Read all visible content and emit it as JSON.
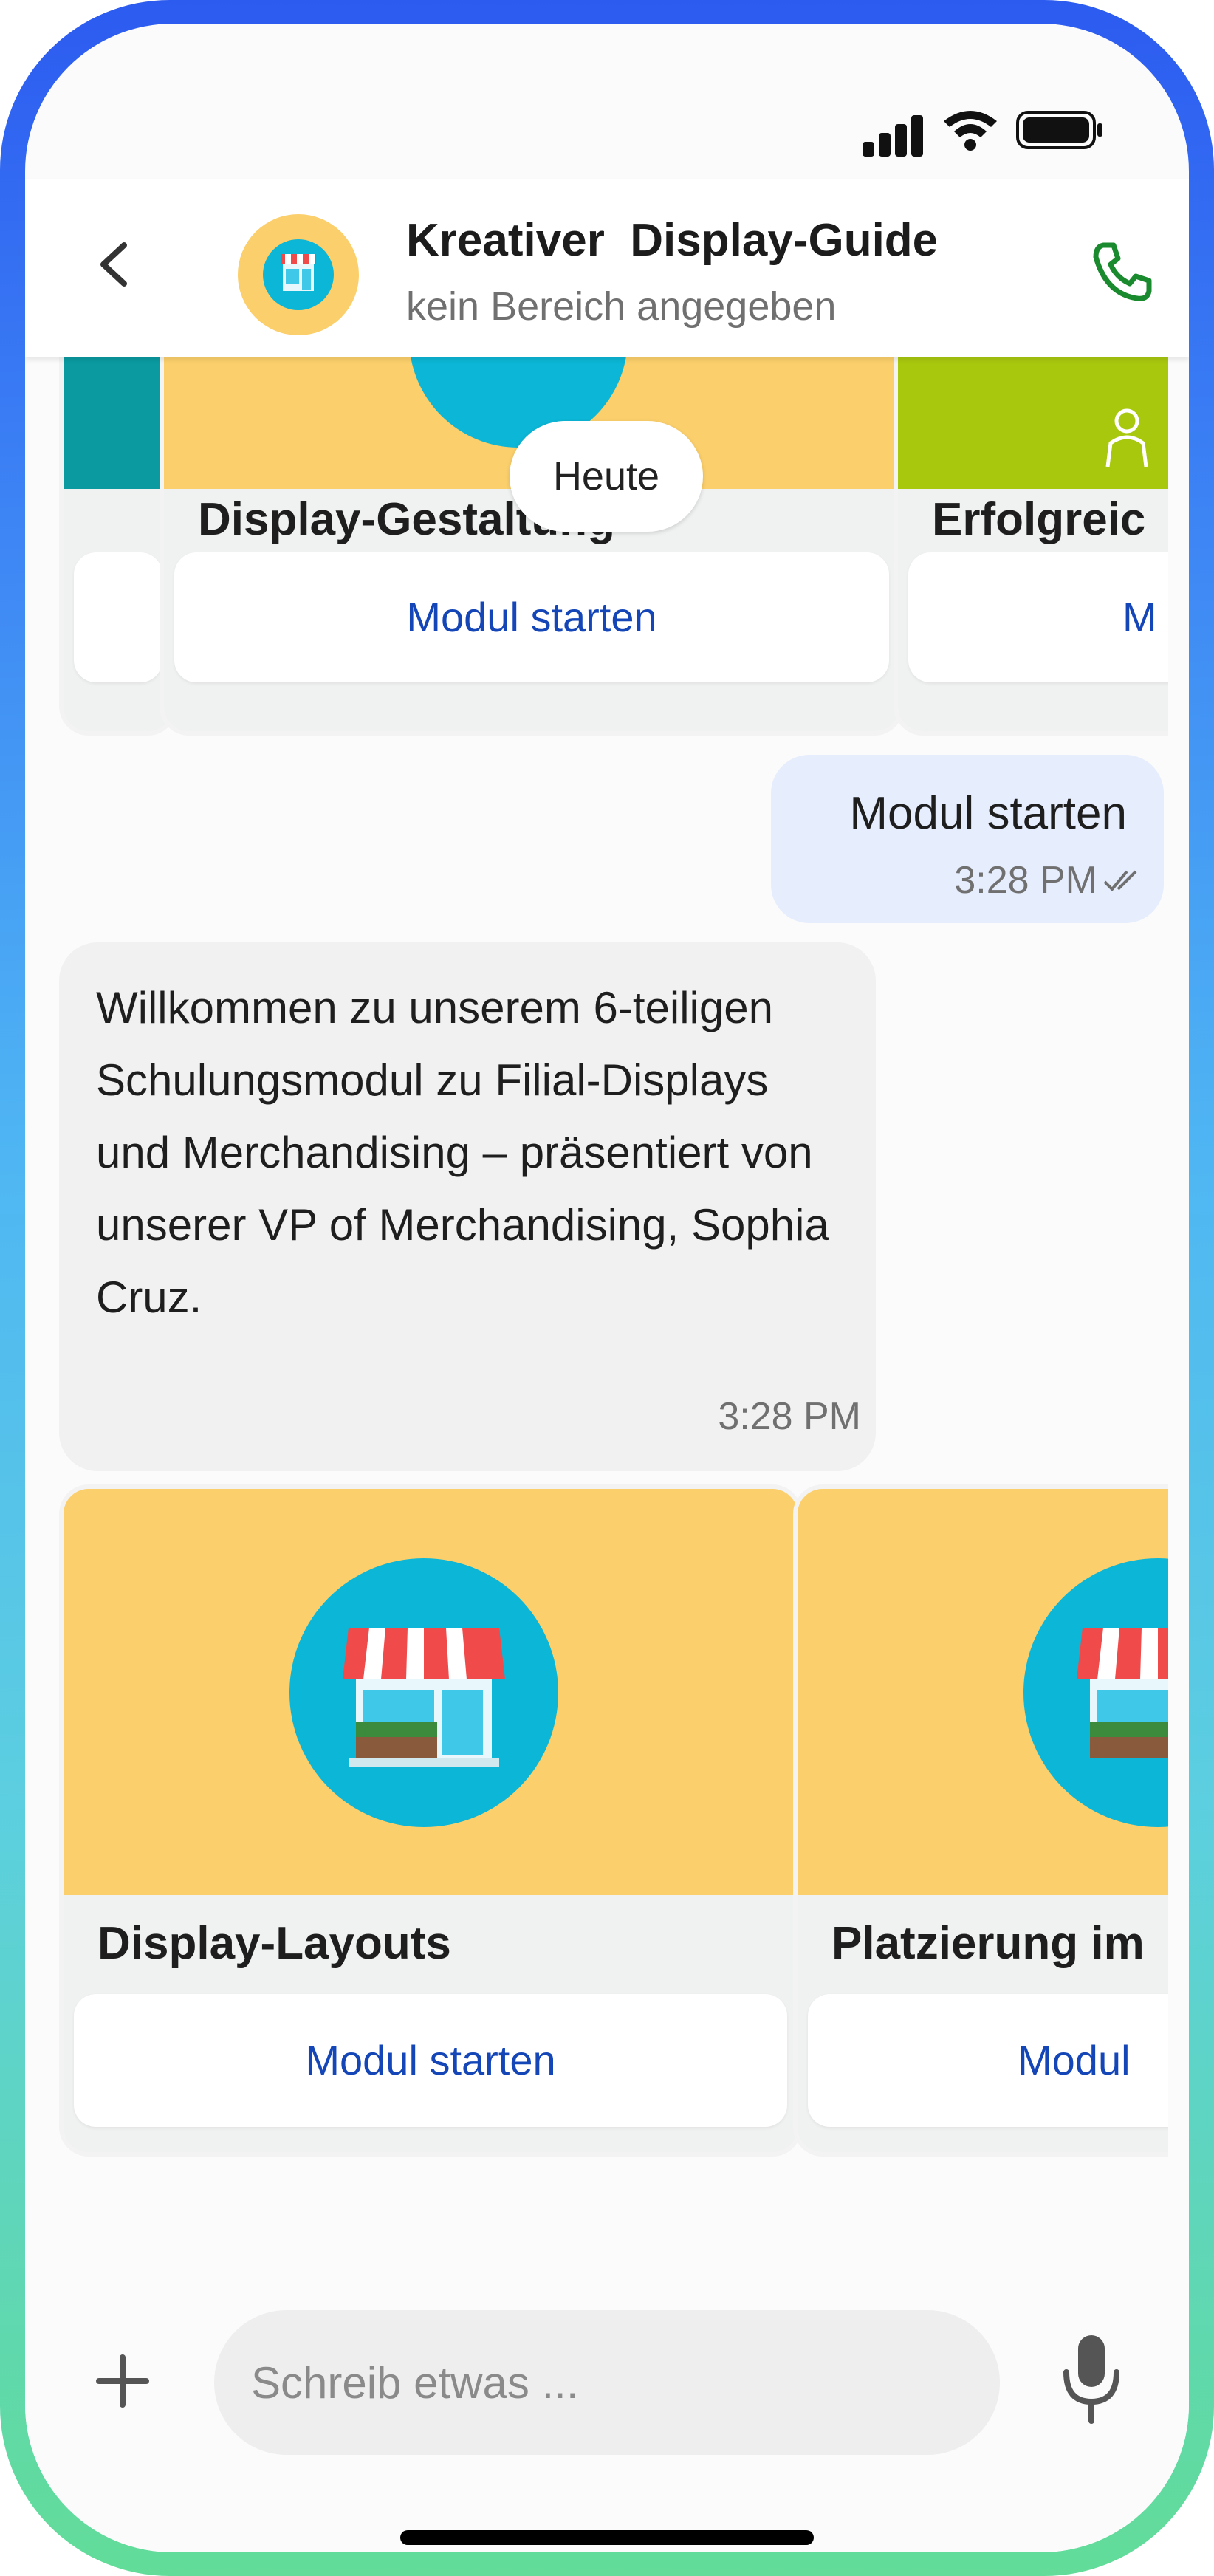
{
  "header": {
    "title": "Kreativer  Display-Guide",
    "subtitle": "kein Bereich angegeben"
  },
  "icons": {
    "back": "chevron-left-icon",
    "phone": "phone-icon",
    "plus": "plus-icon",
    "mic": "microphone-icon",
    "store": "storefront-icon",
    "read": "double-check-icon"
  },
  "colors": {
    "accent_link": "#1446b8",
    "card_image_bg": "#fbcf6b",
    "store_circle": "#0cb6d6",
    "outgoing_bubble": "#e6edfd",
    "phone_green": "#1a8a2e"
  },
  "chat": {
    "date_chip": "Heute",
    "top_carousel": [
      {
        "title": "",
        "button": ""
      },
      {
        "title": "Display-Gestaltung",
        "button": "Modul starten"
      },
      {
        "title": "Erfolgreic",
        "button": "M"
      }
    ],
    "outgoing": {
      "text": "Modul starten",
      "time": "3:28 PM"
    },
    "incoming": {
      "text": "Willkommen zu unserem 6-teiligen Schulungsmodul zu Filial-Displays und Merchandising – präsentiert von unserer VP of Merchandising, Sophia Cruz.",
      "time": "3:28 PM"
    },
    "bottom_carousel": [
      {
        "title": "Display-Layouts",
        "button": "Modul starten"
      },
      {
        "title": "Platzierung im",
        "button": "Modul"
      }
    ]
  },
  "composer": {
    "placeholder": "Schreib etwas ..."
  }
}
